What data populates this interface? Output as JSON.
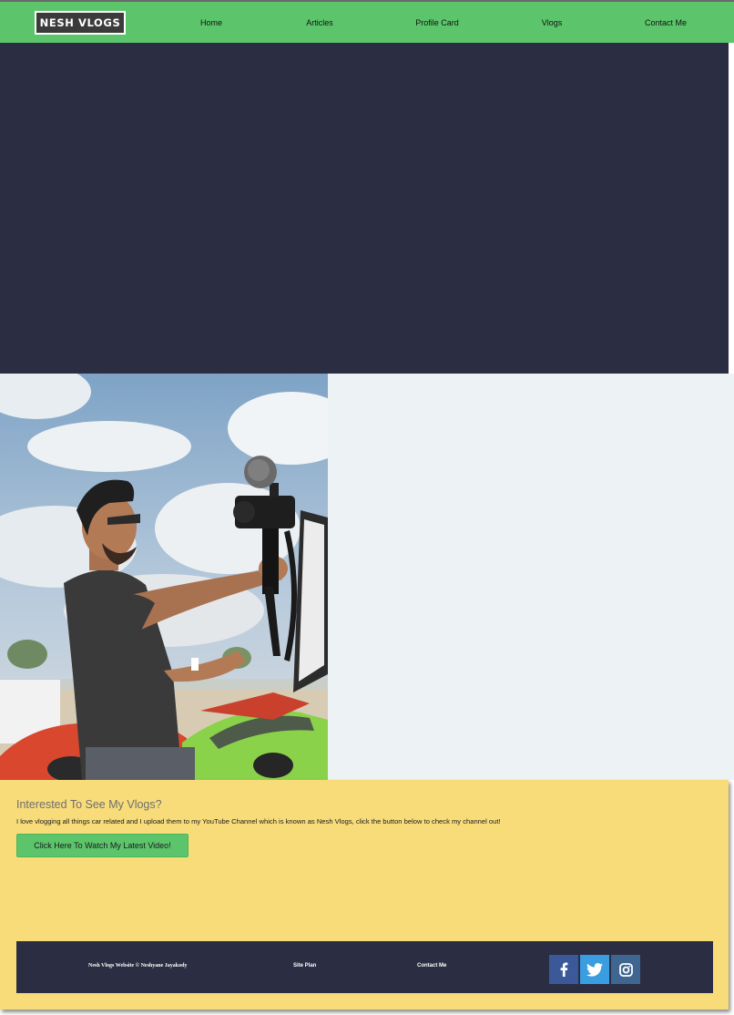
{
  "header": {
    "logo": "NESH VLOGS",
    "nav": [
      {
        "label": "Home"
      },
      {
        "label": "Articles"
      },
      {
        "label": "Profile Card"
      },
      {
        "label": "Vlogs"
      },
      {
        "label": "Contact Me"
      }
    ]
  },
  "vlogs": {
    "title": "Interested To See My Vlogs?",
    "text": "I love vlogging all things car related and I upload them to my YouTube Channel which is known as Nesh Vlogs, click the button below to check my channel out!",
    "button_label": "Click Here To Watch My Latest Video!"
  },
  "footer": {
    "copyright": "Nesh Vlogs Website © Neshyane Jayakody",
    "site_plan": "Site Plan",
    "contact": "Contact Me",
    "social": [
      {
        "icon": "facebook-icon",
        "color": "#3b5998"
      },
      {
        "icon": "twitter-icon",
        "color": "#3a9de0"
      },
      {
        "icon": "instagram-icon",
        "color": "#3f6591"
      }
    ]
  },
  "colors": {
    "nav_green": "#5cc56b",
    "hero_navy": "#2b2d42",
    "panel_grey": "#edf2f4",
    "section_yellow": "#f8dc7a"
  }
}
